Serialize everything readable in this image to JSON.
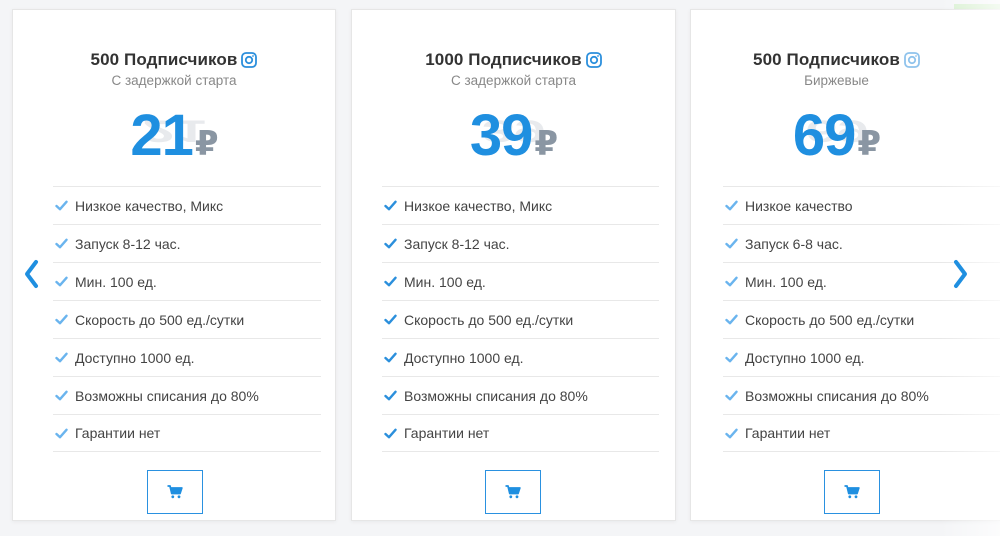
{
  "navigation": {
    "prev_icon": "chevron-left-icon",
    "next_icon": "chevron-right-icon"
  },
  "colors": {
    "accent": "#1f8fe0",
    "check": "#2b8fdc",
    "currency": "#8a96a3"
  },
  "cards": [
    {
      "title": "500 Подписчиков",
      "subtitle": "С задержкой старта",
      "price": "21",
      "currency": "₽",
      "features": [
        "Низкое качество, Микс",
        "Запуск 8-12 час.",
        "Мин. 100 ед.",
        "Скорость до 500 ед./сутки",
        "Доступно 1000 ед.",
        "Возможны списания до 80%",
        "Гарантии нет"
      ],
      "button_icon": "cart-icon"
    },
    {
      "title": "1000 Подписчиков",
      "subtitle": "С задержкой старта",
      "price": "39",
      "currency": "₽",
      "features": [
        "Низкое качество, Микс",
        "Запуск 8-12 час.",
        "Мин. 100 ед.",
        "Скорость до 500 ед./сутки",
        "Доступно 1000 ед.",
        "Возможны списания до 80%",
        "Гарантии нет"
      ],
      "button_icon": "cart-icon"
    },
    {
      "title": "500 Подписчиков",
      "subtitle": "Биржевые",
      "price": "69",
      "currency": "₽",
      "features": [
        "Низкое качество",
        "Запуск 6-8 час.",
        "Мин. 100 ед.",
        "Скорость до 500 ед./сутки",
        "Доступно 1000 ед.",
        "Возможны списания до 80%",
        "Гарантии нет"
      ],
      "button_icon": "cart-icon"
    }
  ]
}
